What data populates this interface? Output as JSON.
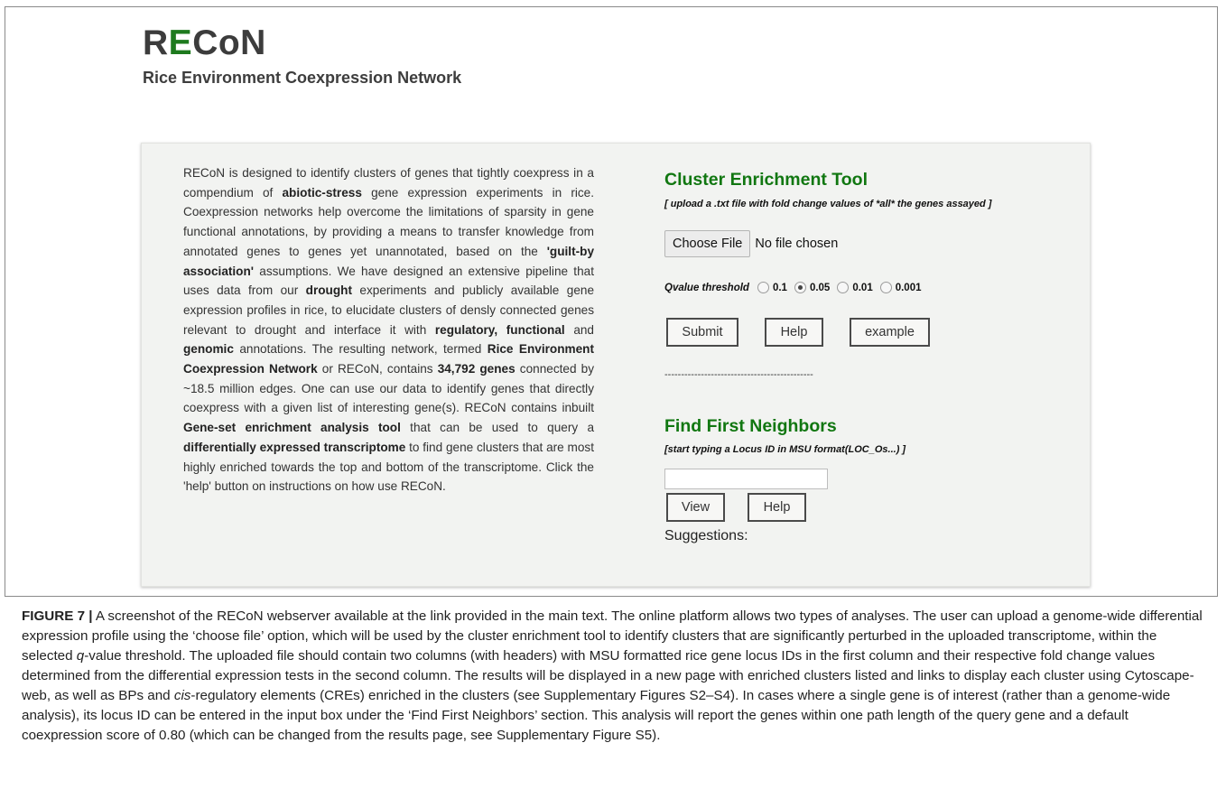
{
  "header": {
    "logo_part1": "R",
    "logo_part2": "E",
    "logo_part3": "CoN",
    "tagline": "Rice Environment Coexpression Network"
  },
  "description": [
    {
      "t": "RECoN is designed to identify clusters of genes that tightly coexpress in a compendium of ",
      "b": false
    },
    {
      "t": "abiotic-stress",
      "b": true
    },
    {
      "t": " gene expression experiments in rice. Coexpression networks help overcome the limitations of sparsity in gene functional annotations, by providing a means to transfer knowledge from annotated genes to genes yet unannotated, based on the ",
      "b": false
    },
    {
      "t": "'guilt-by association'",
      "b": true
    },
    {
      "t": " assumptions. We have designed an extensive pipeline that uses data from our ",
      "b": false
    },
    {
      "t": "drought",
      "b": true
    },
    {
      "t": " experiments and publicly available gene expression profiles in rice, to elucidate clusters of densly connected genes relevant to drought and interface it with ",
      "b": false
    },
    {
      "t": "regulatory, functional",
      "b": true
    },
    {
      "t": " and ",
      "b": false
    },
    {
      "t": "genomic",
      "b": true
    },
    {
      "t": " annotations. The resulting network, termed ",
      "b": false
    },
    {
      "t": "Rice Environment Coexpression Network",
      "b": true
    },
    {
      "t": " or RECoN, contains ",
      "b": false
    },
    {
      "t": "34,792 genes",
      "b": true
    },
    {
      "t": " connected by ~18.5 million edges. One can use our data to identify genes that directly coexpress with a given list of interesting gene(s). RECoN contains inbuilt ",
      "b": false
    },
    {
      "t": "Gene-set enrichment analysis tool",
      "b": true
    },
    {
      "t": " that can be used to query a ",
      "b": false
    },
    {
      "t": "differentially expressed transcriptome",
      "b": true
    },
    {
      "t": " to find gene clusters that are most highly enriched towards the top and bottom of the transcriptome. Click the 'help' button on instructions on how use RECoN.",
      "b": false
    }
  ],
  "cluster_tool": {
    "title": "Cluster Enrichment Tool",
    "note": "[ upload a .txt file with fold change values of *all* the genes assayed ]",
    "choose_label": "Choose File",
    "no_file": "No file chosen",
    "qvalue_label": "Qvalue threshold",
    "qvalue_options": [
      "0.1",
      "0.05",
      "0.01",
      "0.001"
    ],
    "qvalue_selected": "0.05",
    "submit_label": "Submit",
    "help_label": "Help",
    "example_label": "example",
    "divider": "---------------------------------------------"
  },
  "neighbors_tool": {
    "title": "Find First Neighbors",
    "note": "[start typing a Locus ID in MSU format(LOC_Os...) ]",
    "input_value": "",
    "view_label": "View",
    "help_label": "Help",
    "suggestions_label": "Suggestions:"
  },
  "caption": {
    "label": "FIGURE 7 |",
    "parts": [
      {
        "t": " A screenshot of the RECoN webserver available at the link provided in the main text. The online platform allows two types of analyses. The user can upload a genome-wide differential expression profile using the ‘choose file’ option, which will be used by the cluster enrichment tool to identify clusters that are significantly perturbed in the uploaded transcriptome, within the selected ",
        "i": false
      },
      {
        "t": "q",
        "i": true
      },
      {
        "t": "-value threshold. The uploaded file should contain two columns (with headers) with MSU formatted rice gene locus IDs in the first column and their respective fold change values determined from the differential expression tests in the second column. The results will be displayed in a new page with enriched clusters listed and links to display each cluster using Cytoscape-web, as well as BPs and ",
        "i": false
      },
      {
        "t": "cis",
        "i": true
      },
      {
        "t": "-regulatory elements (CREs) enriched in the clusters (see Supplementary Figures S2–S4). In cases where a single gene is of interest (rather than a genome-wide analysis), its locus ID can be entered in the input box under the ‘Find First Neighbors’ section. This analysis will report the genes within one path length of the query gene and a default coexpression score of 0.80 (which can be changed from the results page, see Supplementary Figure S5).",
        "i": false
      }
    ]
  }
}
